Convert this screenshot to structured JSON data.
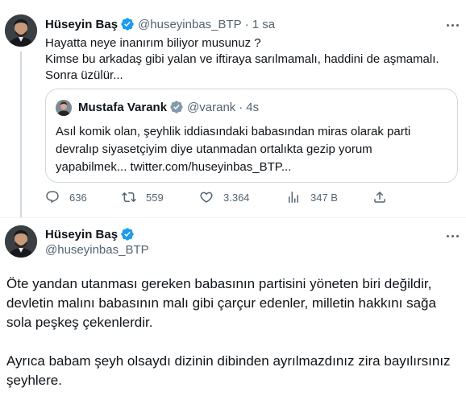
{
  "tweet1": {
    "author_name": "Hüseyin Baş",
    "author_handle": "@huseyinbas_BTP",
    "separator": "·",
    "time": "1 sa",
    "text_lines": [
      "Hayatta neye inanırım biliyor musunuz ?",
      "Kimse bu arkadaş gibi yalan ve iftiraya sarılmamalı, haddini de aşmamalı.",
      "Sonra üzülür..."
    ],
    "quote": {
      "author_name": "Mustafa Varank",
      "author_handle": "@varank",
      "separator": "·",
      "time": "4s",
      "text_lines": [
        "Asıl komik olan, şeyhlik iddiasındaki babasından miras olarak parti",
        "devralıp siyasetçiyim diye utanmadan ortalıkta gezip yorum",
        "yapabilmek... twitter.com/huseyinbas_BTP..."
      ]
    },
    "actions": {
      "replies": "636",
      "retweets": "559",
      "likes": "3.364",
      "views": "347 B"
    }
  },
  "tweet2": {
    "author_name": "Hüseyin Baş",
    "author_handle": "@huseyinbas_BTP",
    "text_lines": [
      "Öte yandan utanması gereken babasının partisini yöneten biri değildir,",
      "devletin malını babasının malı gibi çarçur edenler, milletin hakkını sağa",
      "sola peşkeş çekenlerdir.",
      "",
      "Ayrıca babam şeyh olsaydı dizinin dibinden ayrılmazdınız zira bayılırsınız",
      "şeyhlere."
    ]
  },
  "colors": {
    "text_primary": "#0f1419",
    "text_secondary": "#536471",
    "verified_blue": "#1d9bf0",
    "border": "#cfd9de"
  },
  "icons": [
    "verified-badge-icon",
    "more-options-icon",
    "reply-icon",
    "retweet-icon",
    "like-icon",
    "views-icon",
    "share-icon"
  ]
}
